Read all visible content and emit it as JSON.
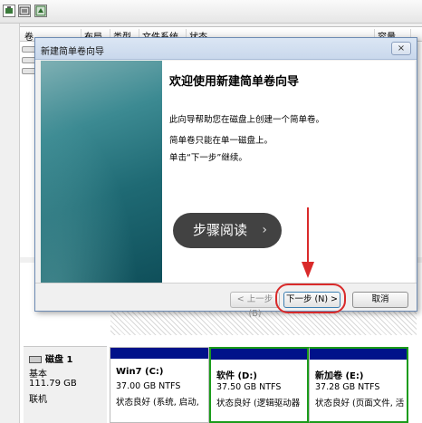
{
  "toolbar": {
    "icons": [
      "disk-manage-icon",
      "properties-icon",
      "wizard-icon"
    ]
  },
  "volume_table": {
    "headers": [
      "卷",
      "布局",
      "类型",
      "文件系统",
      "状态",
      "容量"
    ]
  },
  "wizard": {
    "title": "新建简单卷向导",
    "close_label": "×",
    "heading": "欢迎使用新建简单卷向导",
    "paragraphs": [
      "此向导帮助您在磁盘上创建一个简单卷。",
      "简单卷只能在单一磁盘上。",
      "单击“下一步”继续。"
    ],
    "buttons": {
      "back": "< 上一步 (B)",
      "next": "下一步 (N) >",
      "cancel": "取消"
    }
  },
  "overlay": {
    "step_label": "步骤阅读",
    "step_chevron": "›"
  },
  "disk": {
    "name": "磁盘 1",
    "type": "基本",
    "size": "111.79 GB",
    "status": "联机",
    "partitions": [
      {
        "name": "Win7  (C:)",
        "size": "37.00 GB NTFS",
        "status": "状态良好 (系统, 启动,"
      },
      {
        "name": "软件  (D:)",
        "size": "37.50 GB NTFS",
        "status": "状态良好 (逻辑驱动器"
      },
      {
        "name": "新加卷  (E:)",
        "size": "37.28 GB NTFS",
        "status": "状态良好 (页面文件, 活"
      }
    ]
  },
  "colors": {
    "partition_bar": "#00128a",
    "selected_border": "#1a9b1a",
    "highlight": "#d92a2a"
  }
}
